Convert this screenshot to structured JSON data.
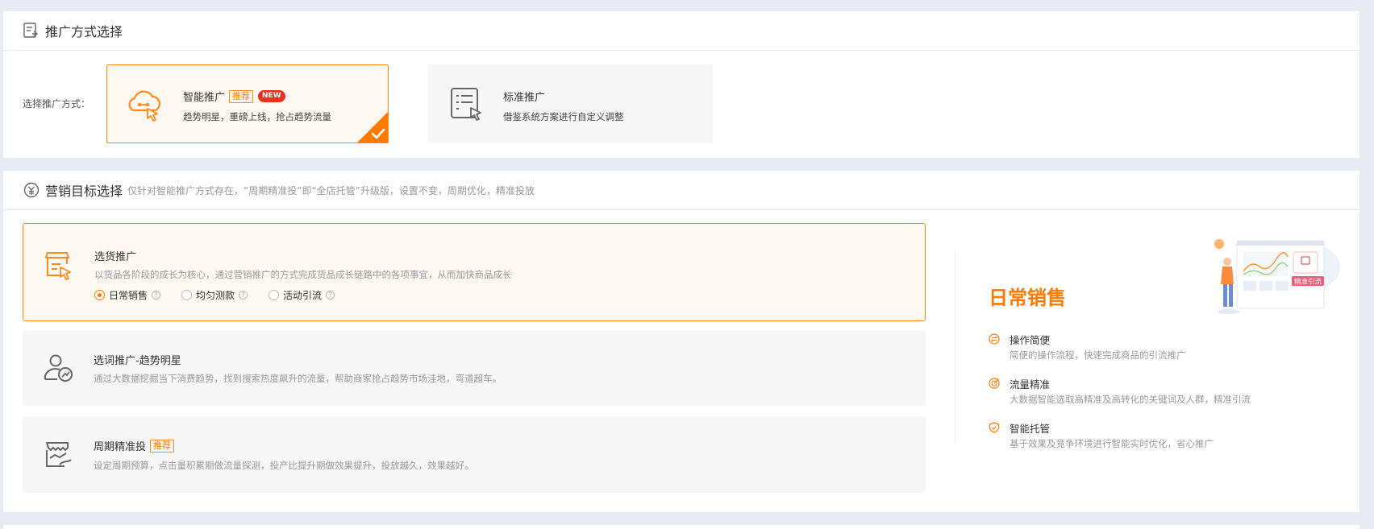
{
  "method_section": {
    "title": "推广方式选择",
    "label": "选择推广方式：",
    "options": [
      {
        "title": "智能推广",
        "tag": "推荐",
        "badge": "NEW",
        "desc": "趋势明星，重磅上线，抢占趋势流量",
        "selected": true
      },
      {
        "title": "标准推广",
        "desc": "借鉴系统方案进行自定义调整",
        "selected": false
      }
    ]
  },
  "goal_section": {
    "title": "营销目标选择",
    "subtitle": "仅针对智能推广方式存在，“周期精准投”即“全店托管”升级版，设置不变，周期优化，精准投放",
    "goals": [
      {
        "title": "选货推广",
        "desc": "以货品各阶段的成长为核心，通过营销推广的方式完成货品成长链路中的各项事宜，从而加快商品成长",
        "selected": true,
        "sub_options": [
          {
            "label": "日常销售",
            "checked": true
          },
          {
            "label": "均匀测款",
            "checked": false
          },
          {
            "label": "活动引流",
            "checked": false
          }
        ]
      },
      {
        "title": "选词推广-趋势明星",
        "desc": "通过大数据挖掘当下消费趋势，找到搜索热度飙升的流量，帮助商家抢占趋势市场洼地，弯道超车。",
        "selected": false
      },
      {
        "title": "周期精准投",
        "tag": "推荐",
        "desc": "设定周期预算，点击量积累期做流量探测，投产比提升期做效果提升，投放越久，效果越好。",
        "selected": false
      }
    ],
    "panel": {
      "title": "日常销售",
      "illustration_badge": "精准引流",
      "features": [
        {
          "title": "操作简便",
          "desc": "简便的操作流程，快速完成商品的引流推广",
          "icon": "swap-icon"
        },
        {
          "title": "流量精准",
          "desc": "大数据智能选取高精准及高转化的关键词及人群，精准引流",
          "icon": "target-icon"
        },
        {
          "title": "智能托管",
          "desc": "基于效果及竞争环境进行智能实时优化，省心推广",
          "icon": "shield-icon"
        }
      ]
    }
  },
  "colors": {
    "accent": "#ff7a00",
    "accent_border": "#ff8a1f",
    "selected_bg": "#fff8f1",
    "new_badge": "#e8321f"
  }
}
